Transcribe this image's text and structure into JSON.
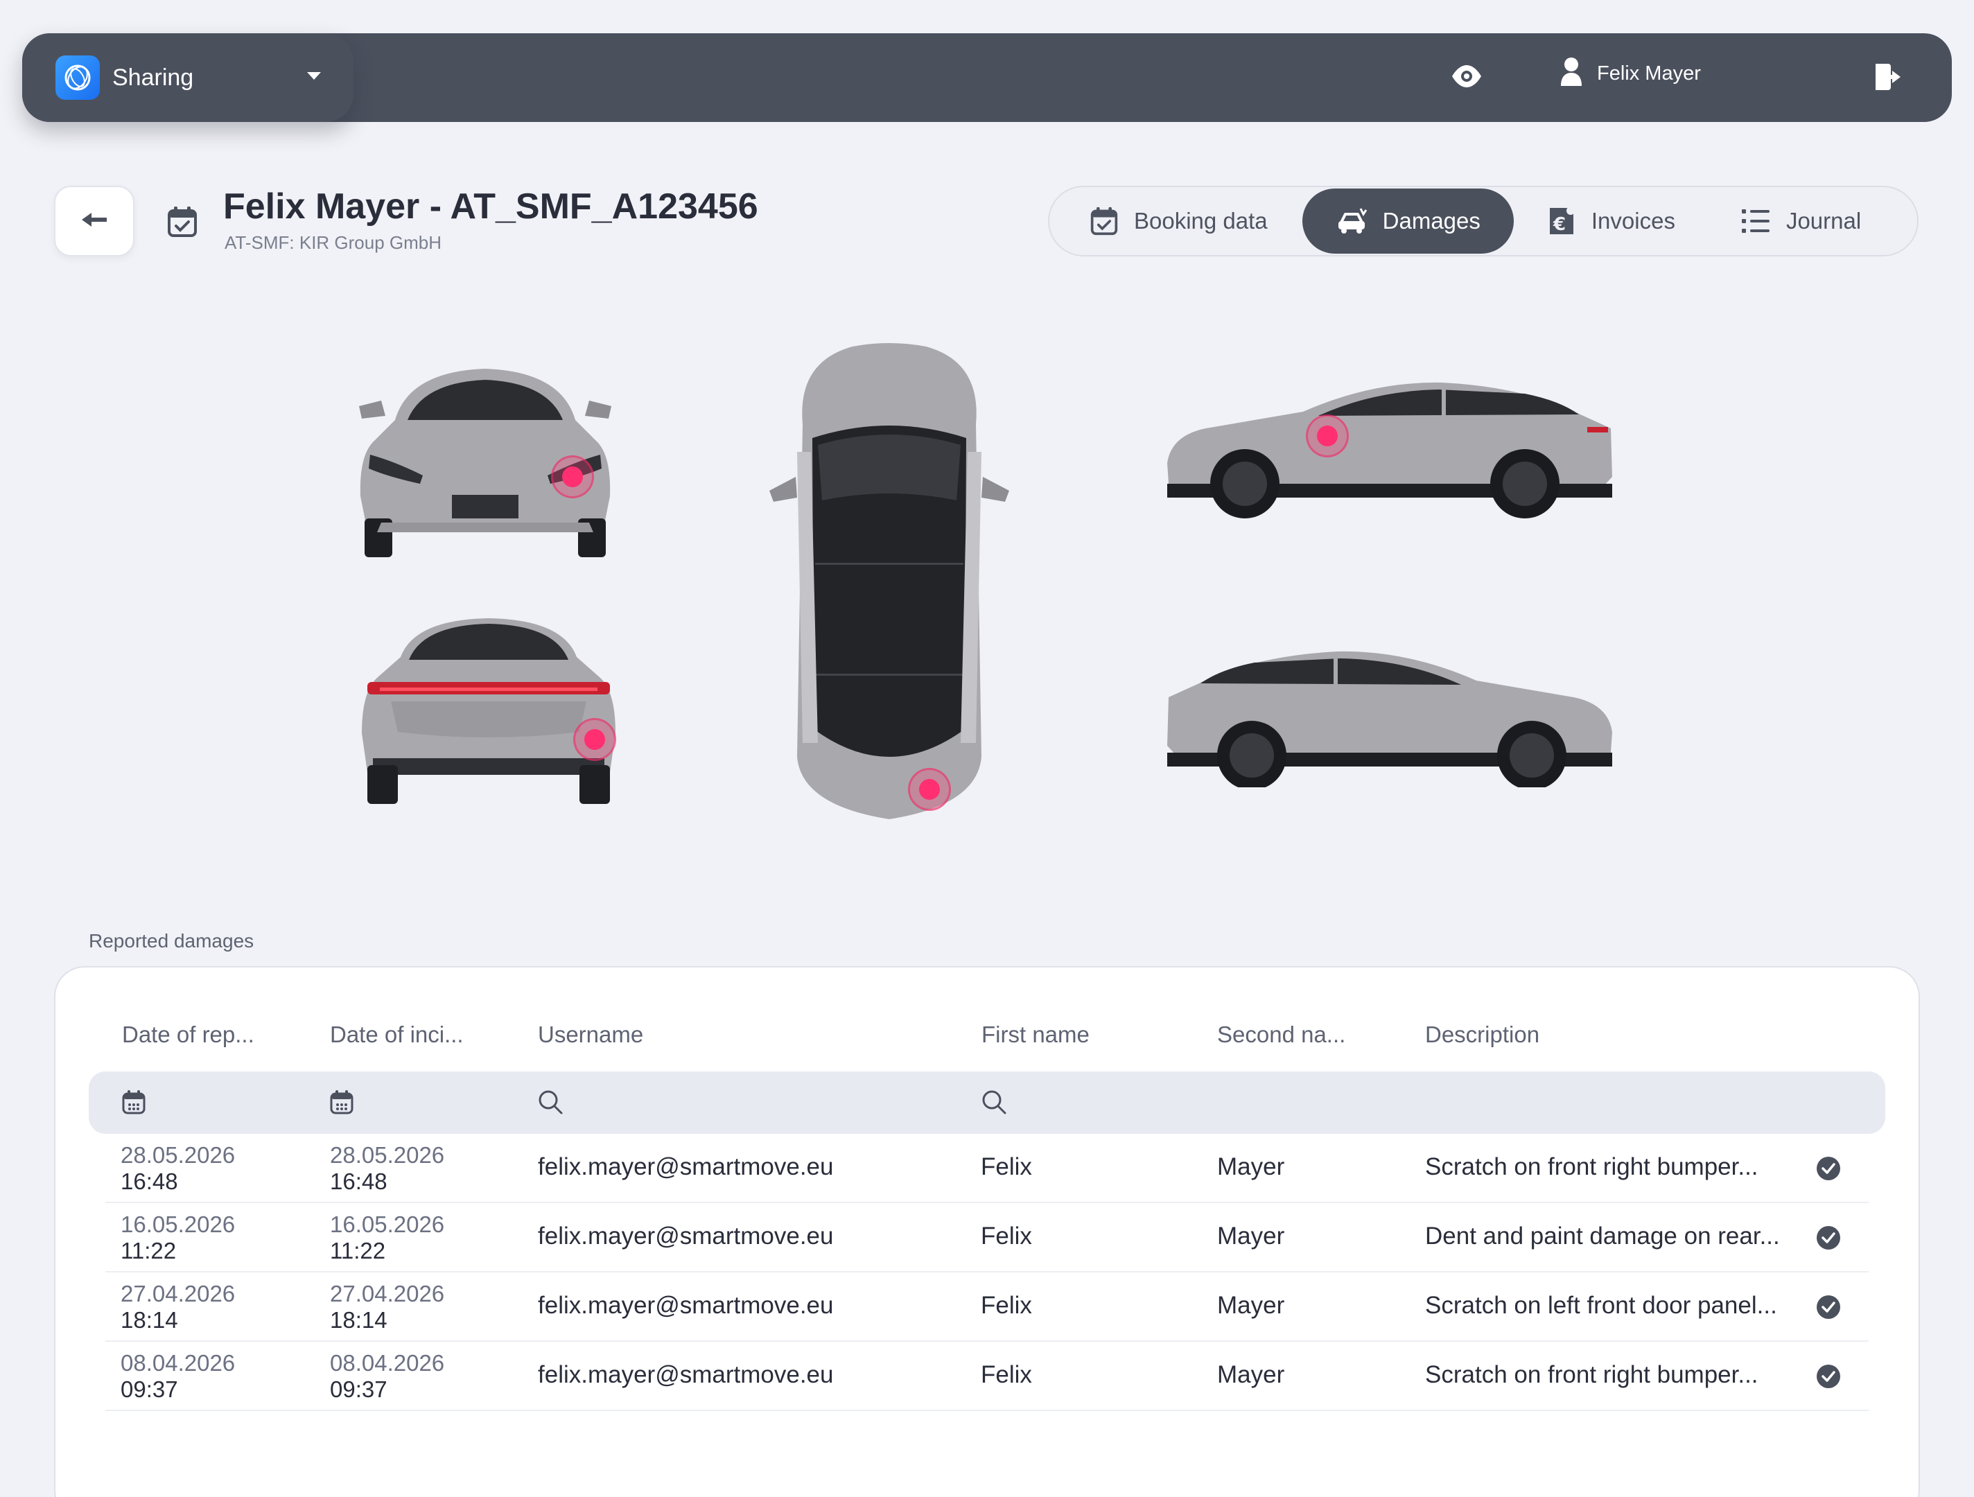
{
  "topbar": {
    "app_name": "Sharing",
    "user_name": "Felix Mayer"
  },
  "header": {
    "title": "Felix Mayer - AT_SMF_A123456",
    "subtitle": "AT-SMF: KIR Group GmbH"
  },
  "tabs": [
    {
      "label": "Booking data",
      "icon": "calendar-check-icon",
      "active": false
    },
    {
      "label": "Damages",
      "icon": "car-damage-icon",
      "active": true
    },
    {
      "label": "Invoices",
      "icon": "invoice-euro-icon",
      "active": false
    },
    {
      "label": "Journal",
      "icon": "list-icon",
      "active": false
    }
  ],
  "car_views": [
    "front",
    "rear",
    "top",
    "right-side",
    "left-side"
  ],
  "colors": {
    "topbar": "#4b505d",
    "damage_marker": "#ff2f72",
    "accent_logo": "#1a6ef0"
  },
  "damages": {
    "section_label": "Reported damages",
    "columns": [
      "Date of rep...",
      "Date of inci...",
      "Username",
      "First name",
      "Second na...",
      "Description"
    ],
    "rows": [
      {
        "report_date": "28.05.2026",
        "report_time": "16:48",
        "incident_date": "28.05.2026",
        "incident_time": "16:48",
        "username": "felix.mayer@smartmove.eu",
        "first_name": "Felix",
        "second_name": "Mayer",
        "description": "Scratch on front right bumper..."
      },
      {
        "report_date": "16.05.2026",
        "report_time": "11:22",
        "incident_date": "16.05.2026",
        "incident_time": "11:22",
        "username": "felix.mayer@smartmove.eu",
        "first_name": "Felix",
        "second_name": "Mayer",
        "description": "Dent and paint damage on rear..."
      },
      {
        "report_date": "27.04.2026",
        "report_time": "18:14",
        "incident_date": "27.04.2026",
        "incident_time": "18:14",
        "username": "felix.mayer@smartmove.eu",
        "first_name": "Felix",
        "second_name": "Mayer",
        "description": "Scratch on left front door panel..."
      },
      {
        "report_date": "08.04.2026",
        "report_time": "09:37",
        "incident_date": "08.04.2026",
        "incident_time": "09:37",
        "username": "felix.mayer@smartmove.eu",
        "first_name": "Felix",
        "second_name": "Mayer",
        "description": "Scratch on front right bumper..."
      }
    ]
  }
}
